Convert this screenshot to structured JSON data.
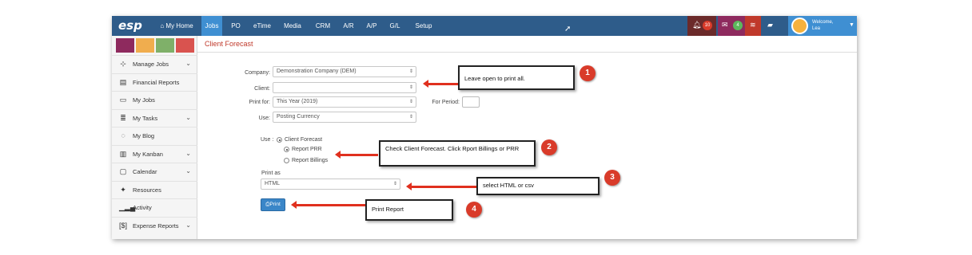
{
  "app": {
    "logo": "esp"
  },
  "nav": {
    "home": "⌂ My Home",
    "items": [
      "Jobs",
      "PO",
      "eTime",
      "Media",
      "CRM",
      "A/R",
      "A/P",
      "G/L",
      "Setup"
    ],
    "notifications": "10",
    "messages": "4",
    "welcome": "Welcome,",
    "user": "Lea"
  },
  "sidebar": {
    "swatch_colors": [
      "#8e2a5e",
      "#f0ad4e",
      "#7fb069",
      "#d9534f"
    ],
    "items": [
      {
        "label": "Manage Jobs",
        "icon": "sitemap-icon",
        "glyph": "⊹",
        "chevron": true
      },
      {
        "label": "Financial Reports",
        "icon": "report-icon",
        "glyph": "▤",
        "chevron": false
      },
      {
        "label": "My Jobs",
        "icon": "folder-icon",
        "glyph": "▭",
        "chevron": false
      },
      {
        "label": "My Tasks",
        "icon": "tasks-icon",
        "glyph": "≣",
        "chevron": true
      },
      {
        "label": "My Blog",
        "icon": "comment-icon",
        "glyph": "◌",
        "chevron": false
      },
      {
        "label": "My Kanban",
        "icon": "kanban-icon",
        "glyph": "▥",
        "chevron": true
      },
      {
        "label": "Calendar",
        "icon": "calendar-icon",
        "glyph": "▢",
        "chevron": true
      },
      {
        "label": "Resources",
        "icon": "users-icon",
        "glyph": "✦",
        "chevron": false
      },
      {
        "label": "Activity",
        "icon": "activity-icon",
        "glyph": "▁▂▄",
        "chevron": false
      },
      {
        "label": "Expense Reports",
        "icon": "expense-icon",
        "glyph": "[$]",
        "chevron": true
      }
    ]
  },
  "page": {
    "title": "Client Forecast"
  },
  "form": {
    "company_label": "Company:",
    "company_value": "Demonstration Company (DEM)",
    "client_label": "Client:",
    "client_value": "",
    "print_for_label": "Print for:",
    "print_for_value": "This Year (2019)",
    "for_period_label": "For Period:",
    "use_label": "Use:",
    "use_value": "Posting Currency",
    "use2_label": "Use :",
    "radio_client_forecast": "Client Forecast",
    "radio_report_prr": "Report PRR",
    "radio_report_billings": "Report Billings",
    "print_as_label": "Print as",
    "print_as_value": "HTML",
    "print_button": "⎙Print"
  },
  "callouts": [
    {
      "number": "1",
      "text": "Leave open to print all."
    },
    {
      "number": "2",
      "text": "Check Client Forecast. Click Rport Billings or PRR"
    },
    {
      "number": "3",
      "text": "select HTML or csv"
    },
    {
      "number": "4",
      "text": "Print Report"
    }
  ]
}
